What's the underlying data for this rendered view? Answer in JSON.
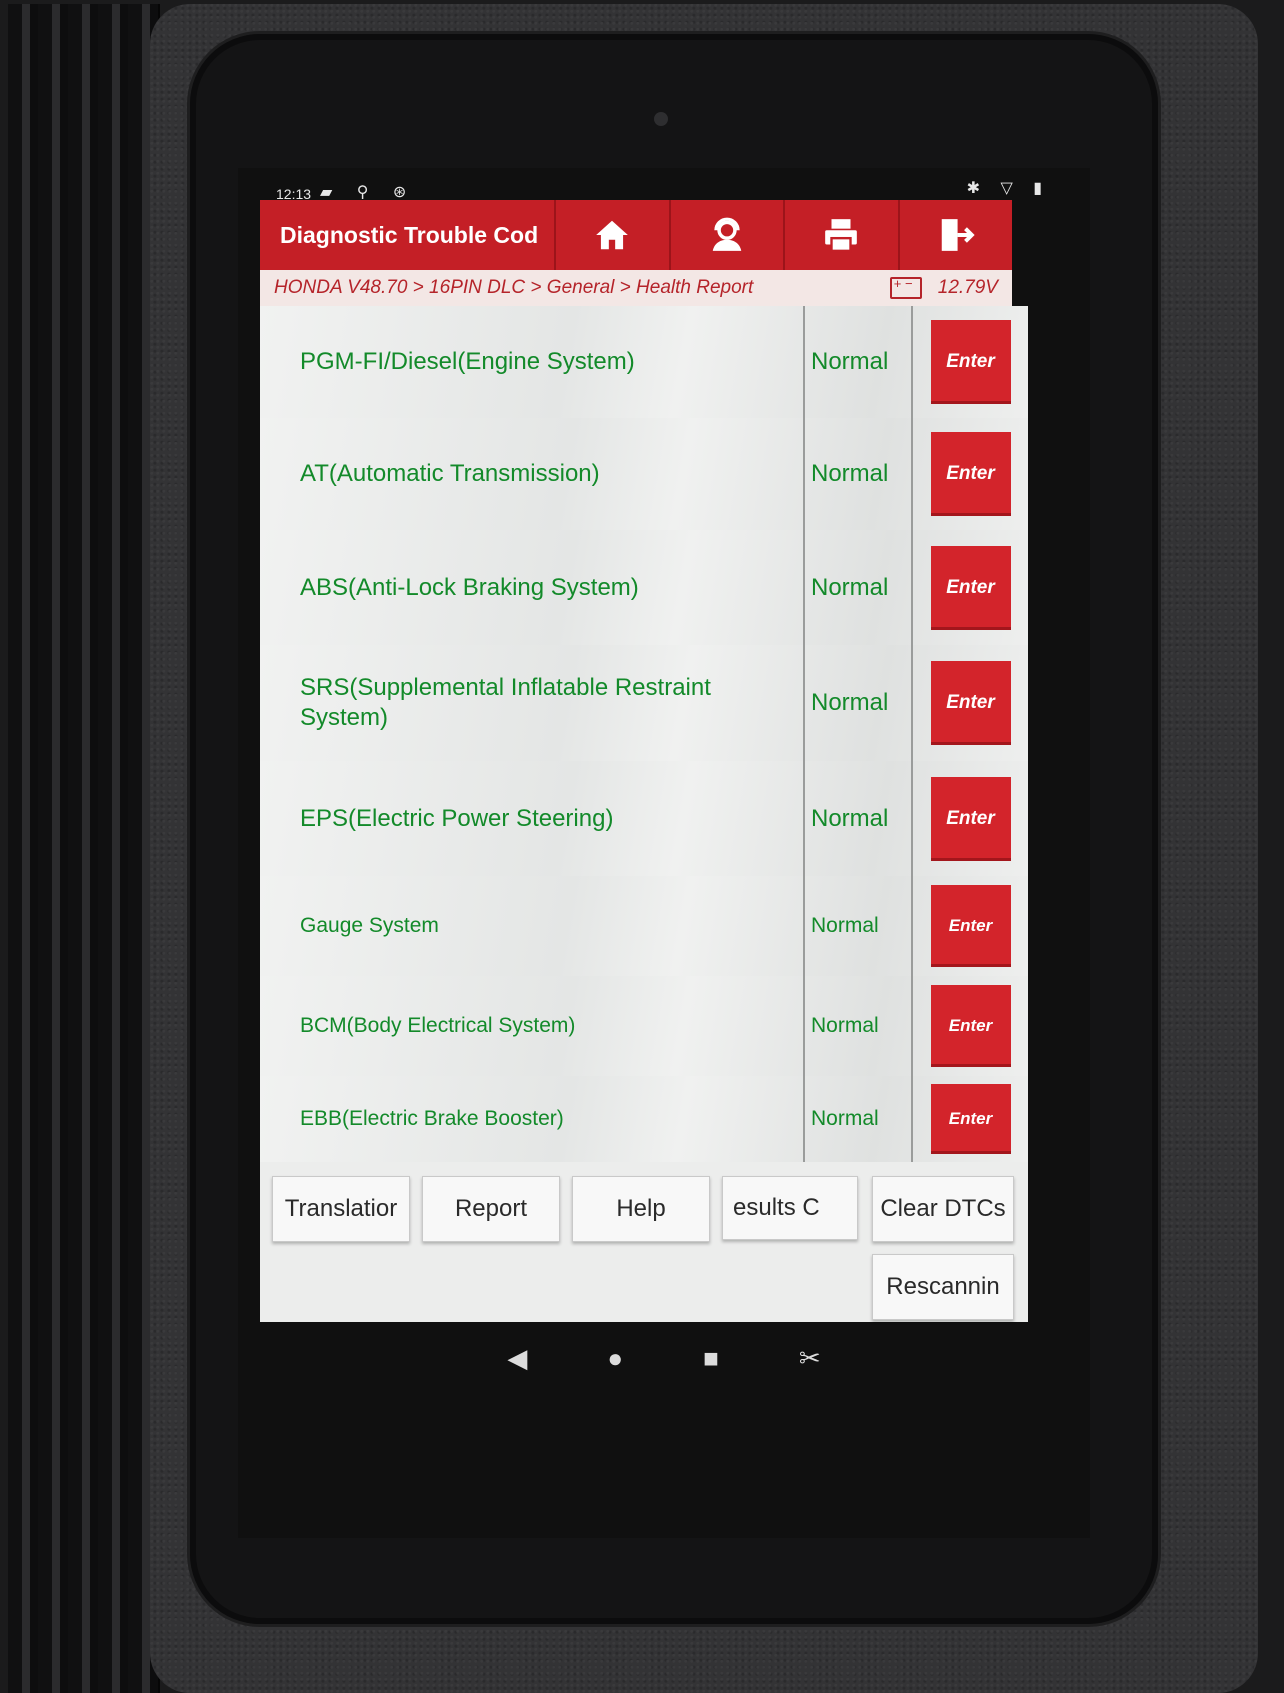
{
  "status_bar": {
    "time": "12:13",
    "left_icons": "▰ ⚲ ⊛",
    "right_icons": "✱ ▽ ▮"
  },
  "header": {
    "title": "Diagnostic Trouble Cod",
    "buttons": [
      {
        "name": "home-icon"
      },
      {
        "name": "support-agent-icon"
      },
      {
        "name": "print-icon"
      },
      {
        "name": "exit-icon"
      }
    ]
  },
  "breadcrumb": {
    "path": "HONDA V48.70 > 16PIN DLC > General > Health Report",
    "battery_icon": "battery-icon",
    "voltage": "12.79V"
  },
  "systems": [
    {
      "name": "PGM-FI/Diesel(Engine System)",
      "status": "Normal",
      "action": "Enter"
    },
    {
      "name": "AT(Automatic Transmission)",
      "status": "Normal",
      "action": "Enter"
    },
    {
      "name": "ABS(Anti-Lock Braking System)",
      "status": "Normal",
      "action": "Enter"
    },
    {
      "name": "SRS(Supplemental Inflatable Restraint System)",
      "status": "Normal",
      "action": "Enter"
    },
    {
      "name": "EPS(Electric Power Steering)",
      "status": "Normal",
      "action": "Enter"
    },
    {
      "name": "Gauge System",
      "status": "Normal",
      "action": "Enter"
    },
    {
      "name": "BCM(Body Electrical System)",
      "status": "Normal",
      "action": "Enter"
    },
    {
      "name": "EBB(Electric Brake Booster)",
      "status": "Normal",
      "action": "Enter"
    }
  ],
  "actions": {
    "translation": "Translatior",
    "report": "Report",
    "help": "Help",
    "results": "esults     C",
    "clear_dtcs": "Clear DTCs",
    "rescanning": "Rescannin"
  },
  "nav": {
    "back": "◀",
    "home": "●",
    "recents": "■",
    "screenshot": "✂"
  },
  "colors": {
    "header_red": "#c41f26",
    "enter_red": "#d3242b",
    "text_green": "#138a2a"
  }
}
